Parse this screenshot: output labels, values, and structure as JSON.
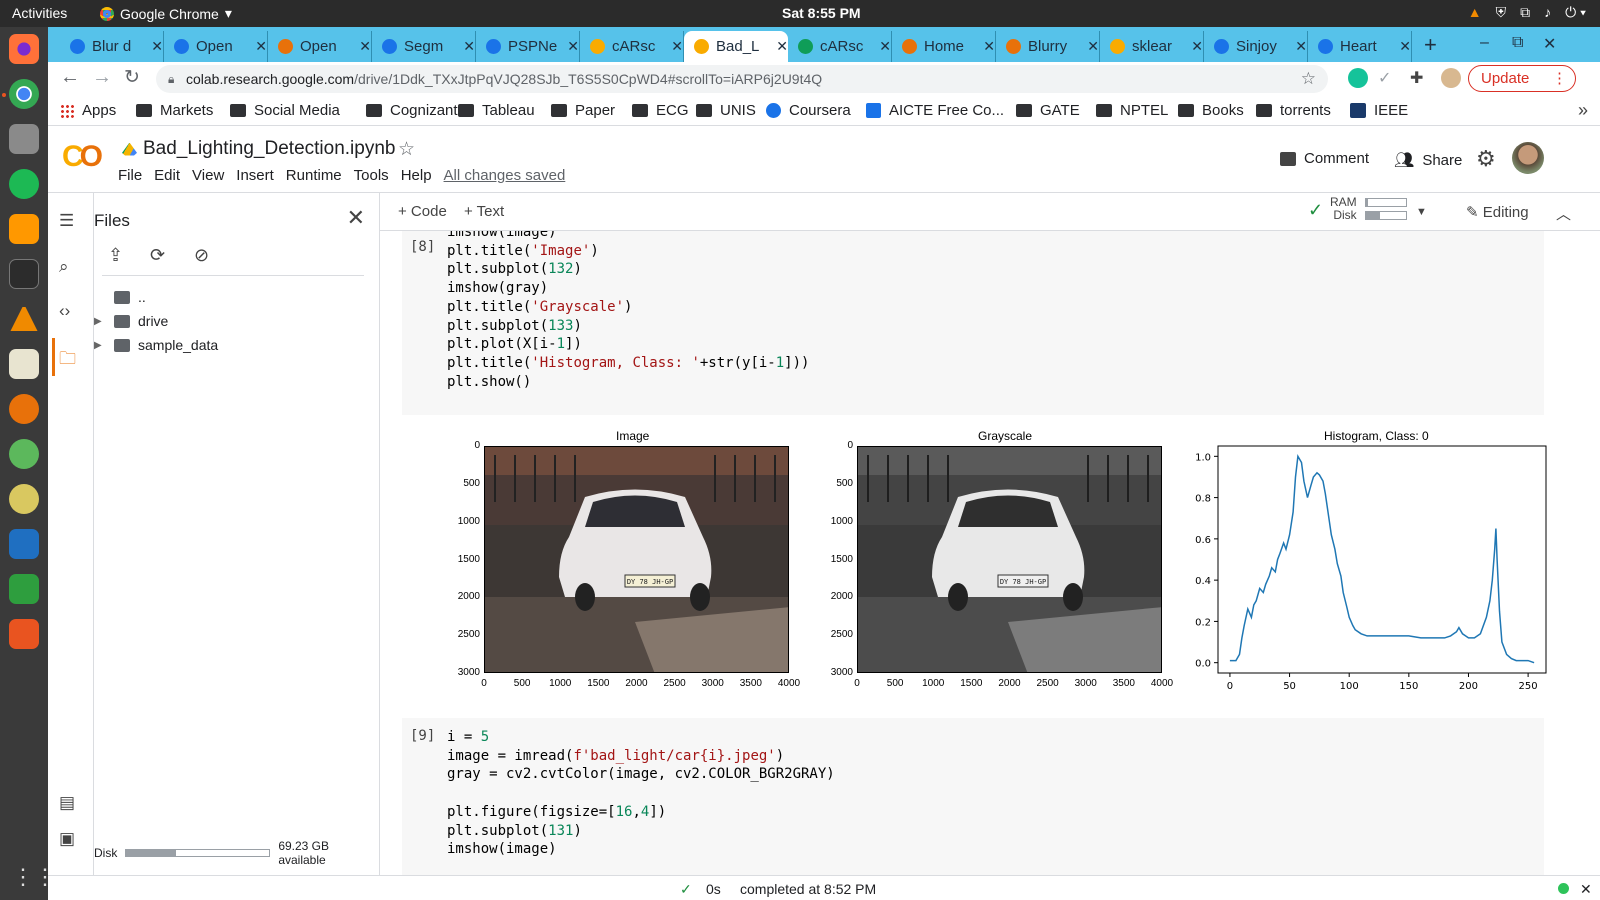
{
  "system": {
    "activities": "Activities",
    "app_name": "Google Chrome",
    "clock": "Sat  8:55 PM"
  },
  "tabs": [
    {
      "title": "Blur d",
      "fav_color": "#1a73e8"
    },
    {
      "title": "Open",
      "fav_color": "#1a73e8"
    },
    {
      "title": "Open",
      "fav_color": "#e8710a"
    },
    {
      "title": "Segm",
      "fav_color": "#1a73e8"
    },
    {
      "title": "PSPNe",
      "fav_color": "#1a73e8"
    },
    {
      "title": "cARsc",
      "fav_color": "#f9ab00"
    },
    {
      "title": "Bad_L",
      "fav_color": "#f9ab00"
    },
    {
      "title": "cARsc",
      "fav_color": "#0f9d58"
    },
    {
      "title": "Home",
      "fav_color": "#e8710a"
    },
    {
      "title": "Blurry",
      "fav_color": "#e8710a"
    },
    {
      "title": "sklear",
      "fav_color": "#f9ab00"
    },
    {
      "title": "Sinjoy",
      "fav_color": "#1a73e8"
    },
    {
      "title": "Heart",
      "fav_color": "#1a73e8"
    }
  ],
  "active_tab_index": 6,
  "url": {
    "host": "colab.research.google.com",
    "path": "/drive/1Ddk_TXxJtpPqVJQ28SJb_T6S5S0CpWD4#scrollTo=iARP6j2U9t4Q"
  },
  "update_label": "Update",
  "bookmarks": [
    "Apps",
    "Markets",
    "Social Media",
    "Cognizant",
    "Tableau",
    "Paper",
    "ECG",
    "UNIS",
    "Coursera",
    "AICTE Free Co...",
    "GATE",
    "NPTEL",
    "Books",
    "torrents",
    "IEEE"
  ],
  "colab": {
    "notebook_title": "Bad_Lighting_Detection.ipynb",
    "menus": [
      "File",
      "Edit",
      "View",
      "Insert",
      "Runtime",
      "Tools",
      "Help"
    ],
    "saved_status": "All changes saved",
    "comment_label": "Comment",
    "share_label": "Share",
    "add_code": "+ Code",
    "add_text": "+ Text",
    "ram_label": "RAM",
    "disk_label": "Disk",
    "ram_fraction": 0.05,
    "disk_fraction": 0.35,
    "editing_label": "Editing"
  },
  "files_panel": {
    "title": "Files",
    "tree": [
      {
        "name": "..",
        "expandable": false
      },
      {
        "name": "drive",
        "expandable": true
      },
      {
        "name": "sample_data",
        "expandable": true
      }
    ],
    "disk_label": "Disk",
    "disk_available": "69.23 GB available",
    "disk_fraction": 0.35
  },
  "cells": [
    {
      "prompt": "[8]",
      "lines": [
        "imshow(image)",
        "plt.title('Image')",
        "plt.subplot(132)",
        "imshow(gray)",
        "plt.title('Grayscale')",
        "plt.subplot(133)",
        "plt.plot(X[i-1])",
        "plt.title('Histogram, Class: '+str(y[i-1]))",
        "plt.show()"
      ]
    },
    {
      "prompt": "[9]",
      "lines": [
        "i = 5",
        "image = imread(f'bad_light/car{i}.jpeg')",
        "gray = cv2.cvtColor(image, cv2.COLOR_BGR2GRAY)",
        "",
        "plt.figure(figsize=[16,4])",
        "plt.subplot(131)",
        "imshow(image)"
      ]
    }
  ],
  "figures": {
    "image_title": "Image",
    "gray_title": "Grayscale",
    "image_yticks": [
      "0",
      "500",
      "1000",
      "1500",
      "2000",
      "2500",
      "3000"
    ],
    "image_xticks": [
      "0",
      "500",
      "1000",
      "1500",
      "2000",
      "2500",
      "3000",
      "3500",
      "4000"
    ],
    "plate_text": "DY 78 JH-GP"
  },
  "chart_data": {
    "type": "line",
    "title": "Histogram, Class: 0",
    "xlabel": "",
    "ylabel": "",
    "xlim": [
      -10,
      265
    ],
    "ylim": [
      -0.05,
      1.05
    ],
    "xticks": [
      0,
      50,
      100,
      150,
      200,
      250
    ],
    "yticks": [
      0.0,
      0.2,
      0.4,
      0.6,
      0.8,
      1.0
    ],
    "series": [
      {
        "color": "#1f77b4",
        "x": [
          0,
          5,
          8,
          10,
          12,
          15,
          18,
          20,
          22,
          25,
          28,
          30,
          33,
          35,
          38,
          40,
          42,
          45,
          47,
          50,
          53,
          55,
          57,
          60,
          62,
          65,
          68,
          70,
          73,
          75,
          78,
          80,
          83,
          85,
          88,
          90,
          93,
          95,
          98,
          100,
          103,
          105,
          110,
          115,
          120,
          130,
          140,
          150,
          160,
          170,
          180,
          185,
          190,
          192,
          195,
          200,
          205,
          210,
          215,
          218,
          220,
          222,
          223,
          224,
          226,
          228,
          232,
          236,
          240,
          245,
          250,
          255
        ],
        "y": [
          0.01,
          0.01,
          0.04,
          0.12,
          0.18,
          0.26,
          0.22,
          0.28,
          0.3,
          0.36,
          0.34,
          0.38,
          0.42,
          0.46,
          0.44,
          0.5,
          0.53,
          0.58,
          0.55,
          0.62,
          0.73,
          0.9,
          1.0,
          0.97,
          0.88,
          0.8,
          0.86,
          0.9,
          0.92,
          0.91,
          0.88,
          0.82,
          0.7,
          0.62,
          0.55,
          0.48,
          0.42,
          0.34,
          0.27,
          0.22,
          0.18,
          0.16,
          0.14,
          0.13,
          0.13,
          0.13,
          0.13,
          0.13,
          0.12,
          0.12,
          0.12,
          0.13,
          0.15,
          0.17,
          0.14,
          0.12,
          0.12,
          0.14,
          0.22,
          0.3,
          0.4,
          0.55,
          0.65,
          0.5,
          0.25,
          0.1,
          0.04,
          0.02,
          0.01,
          0.01,
          0.01,
          0.0
        ]
      }
    ]
  },
  "status": {
    "duration": "0s",
    "completed": "completed at 8:52 PM"
  }
}
